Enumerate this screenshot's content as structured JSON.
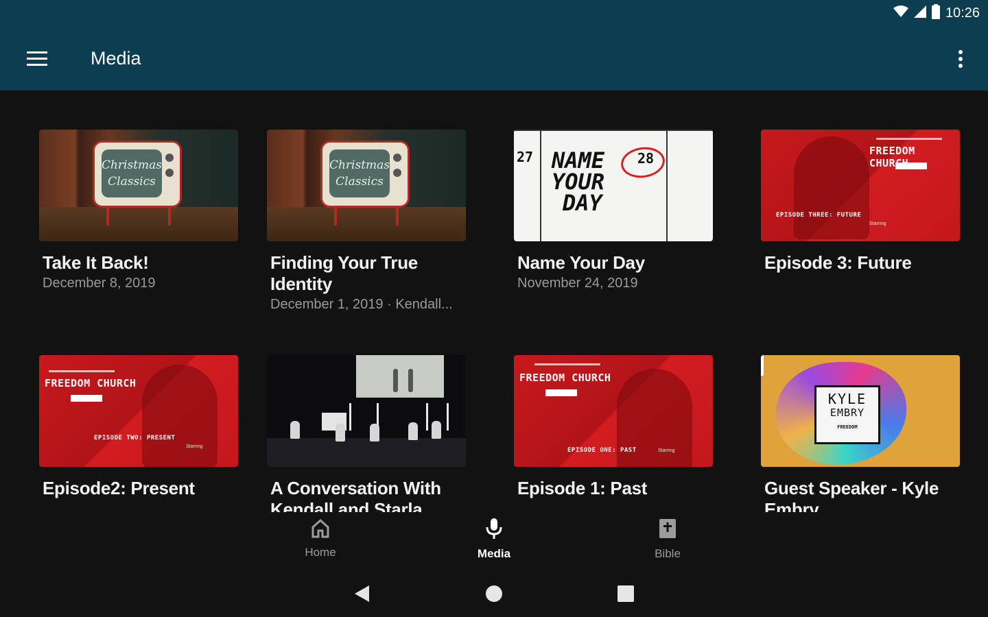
{
  "status_bar": {
    "time": "10:26",
    "icons": [
      "wifi-icon",
      "signal-icon",
      "battery-icon"
    ]
  },
  "app_bar": {
    "title": "Media",
    "menu_icon": "hamburger-menu-icon",
    "more_icon": "more-vertical-icon"
  },
  "colors": {
    "app_bar_bg": "#0c3d50",
    "background": "#121212",
    "brand_red": "#c8191d",
    "title_text": "#f2f2f2",
    "subtitle_text": "#9a9a9a"
  },
  "thumbnail_text": {
    "christmas": [
      "Christmas",
      "Classics"
    ],
    "calendar": {
      "day_left": "27",
      "day_right": "28",
      "lines": [
        "NAME",
        "YOUR",
        "DAY"
      ]
    },
    "freedom_brand": "FREEDOM CHURCH",
    "episode_three": "EPISODE THREE: FUTURE",
    "episode_two": "EPISODE TWO: PRESENT",
    "episode_one": "EPISODE ONE: PAST",
    "starring": "Starring",
    "kyle": {
      "first": "KYLE",
      "last": "EMBRY",
      "brand": "FREEDOM"
    }
  },
  "media_items": [
    {
      "title": "Take It Back!",
      "subtitle": "December 8, 2019",
      "thumbnail": "christmas-classics-tv"
    },
    {
      "title": "Finding Your True Identity",
      "subtitle": "December 1, 2019 · Kendall...",
      "thumbnail": "christmas-classics-tv"
    },
    {
      "title": "Name Your Day",
      "subtitle": "November 24, 2019",
      "thumbnail": "name-your-day-calendar"
    },
    {
      "title": "Episode 3: Future",
      "subtitle": "",
      "thumbnail": "freedom-church-episode-three"
    },
    {
      "title": "Episode2: Present",
      "subtitle": "",
      "thumbnail": "freedom-church-episode-two"
    },
    {
      "title": "A Conversation With Kendall and Starla",
      "subtitle": "",
      "thumbnail": "stage-conversation"
    },
    {
      "title": "Episode 1: Past",
      "subtitle": "",
      "thumbnail": "freedom-church-episode-one"
    },
    {
      "title": "Guest Speaker - Kyle Embry",
      "subtitle": "",
      "thumbnail": "kyle-embry-graphic"
    }
  ],
  "bottom_nav": {
    "items": [
      {
        "label": "Home",
        "icon": "home-icon",
        "active": false
      },
      {
        "label": "Media",
        "icon": "microphone-icon",
        "active": true
      },
      {
        "label": "Bible",
        "icon": "bible-icon",
        "active": false
      }
    ]
  },
  "system_nav": {
    "icons": [
      "back-icon",
      "home-circle-icon",
      "recents-icon"
    ]
  }
}
